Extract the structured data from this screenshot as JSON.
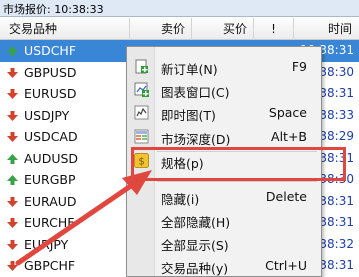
{
  "window": {
    "title": "市场报价: 10:38:33"
  },
  "columns": {
    "symbol": "交易品种",
    "bid": "卖价",
    "ask": "买价",
    "spread": "!",
    "time": "时间"
  },
  "rows": [
    {
      "symbol": "USDCHF",
      "time": "10:38:31",
      "dir": "up",
      "selected": true
    },
    {
      "symbol": "GBPUSD",
      "time": "10:38:30",
      "dir": "down",
      "selected": false
    },
    {
      "symbol": "EURUSD",
      "time": "10:38:31",
      "dir": "down",
      "selected": false
    },
    {
      "symbol": "USDJPY",
      "time": "10:38:33",
      "dir": "down",
      "selected": false
    },
    {
      "symbol": "USDCAD",
      "time": "10:38:29",
      "dir": "down",
      "selected": false
    },
    {
      "symbol": "AUDUSD",
      "time": "10:38:31",
      "dir": "up",
      "selected": false
    },
    {
      "symbol": "EURGBP",
      "time": "10:38:30",
      "dir": "up",
      "selected": false
    },
    {
      "symbol": "EURAUD",
      "time": "10:38:31",
      "dir": "down",
      "selected": false
    },
    {
      "symbol": "EURCHF",
      "time": "10:38:31",
      "dir": "down",
      "selected": false
    },
    {
      "symbol": "EURJPY",
      "time": "10:38:32",
      "dir": "down",
      "selected": false
    },
    {
      "symbol": "GBPCHF",
      "time": "10:38:31",
      "dir": "down",
      "selected": false
    }
  ],
  "menu": {
    "new_order": {
      "label": "新订单(N)",
      "shortcut": "F9"
    },
    "chart_window": {
      "label": "图表窗口(C)",
      "shortcut": ""
    },
    "tick_chart": {
      "label": "即时图(T)",
      "shortcut": "Space"
    },
    "depth": {
      "label": "市场深度(D)",
      "shortcut": "Alt+B"
    },
    "spec": {
      "label": "规格(p)",
      "shortcut": ""
    },
    "hide": {
      "label": "隐藏(i)",
      "shortcut": "Delete"
    },
    "hide_all": {
      "label": "全部隐藏(H)",
      "shortcut": ""
    },
    "show_all": {
      "label": "全部显示(S)",
      "shortcut": ""
    },
    "symbols": {
      "label": "交易品种(y)",
      "shortcut": "Ctrl+U"
    }
  },
  "colors": {
    "selection": "#3a86d6",
    "up_arrow": "#3aa14a",
    "down_arrow": "#d2432e",
    "highlight": "#e0473f",
    "time_blue": "#1c3fa8"
  }
}
